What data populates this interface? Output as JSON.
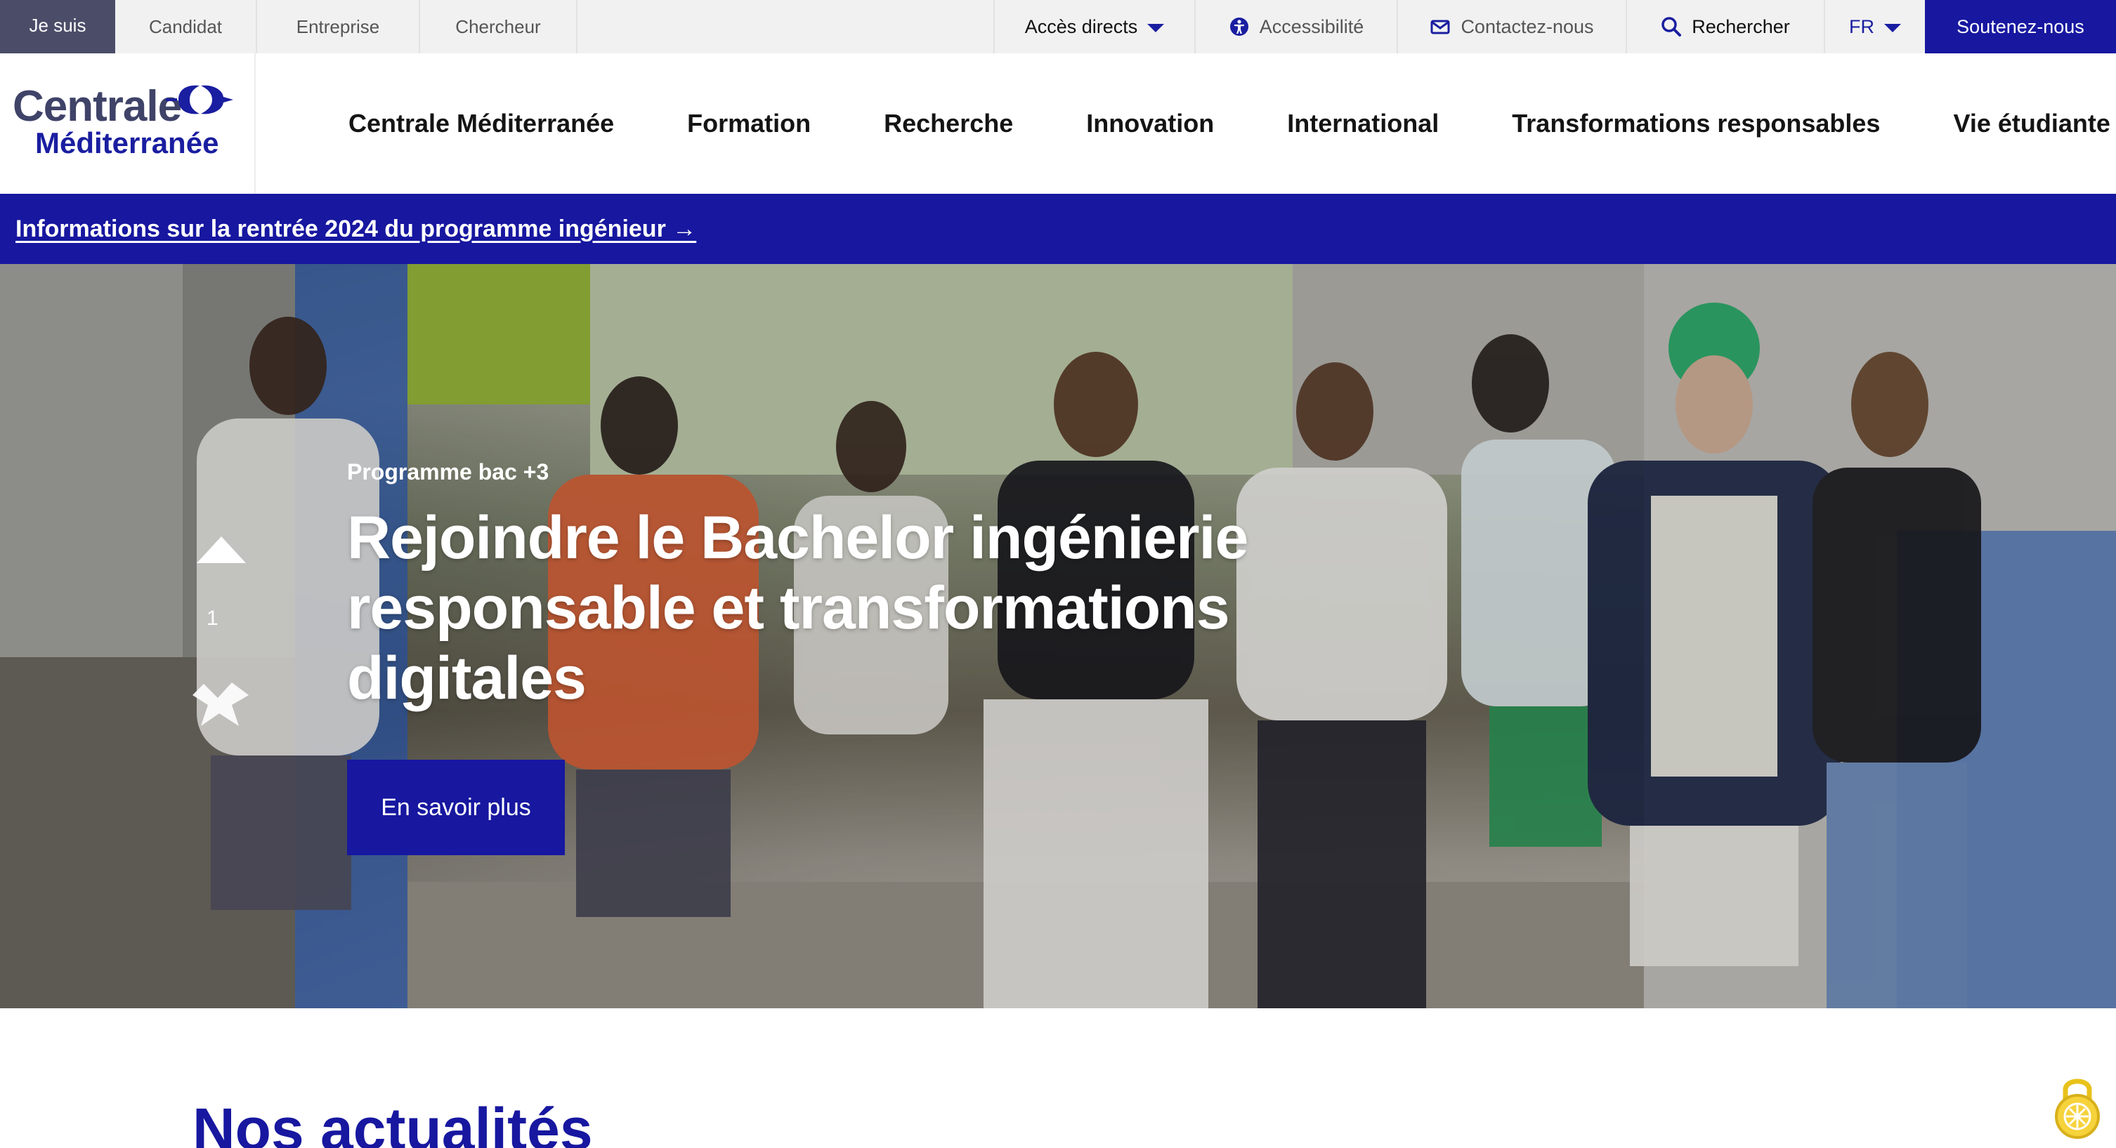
{
  "topbar": {
    "je_suis": "Je suis",
    "roles": [
      "Candidat",
      "Entreprise",
      "Chercheur"
    ],
    "acces_directs": "Accès directs",
    "accessibilite": "Accessibilité",
    "contact": "Contactez-nous",
    "search": "Rechercher",
    "lang": "FR",
    "support": "Soutenez-nous"
  },
  "logo": {
    "line1": "Centrale",
    "line2": "Méditerranée"
  },
  "nav": {
    "items": [
      "Centrale Méditerranée",
      "Formation",
      "Recherche",
      "Innovation",
      "International",
      "Transformations responsables",
      "Vie étudiante"
    ]
  },
  "announcement": {
    "text": "Informations sur la rentrée 2024 du programme ingénieur →"
  },
  "hero": {
    "subtitle": "Programme bac +3",
    "title": "Rejoindre le Bachelor ingénierie responsable et transformations digitales",
    "button": "En savoir plus"
  },
  "news": {
    "title": "Nos actualités"
  },
  "colors": {
    "brand_blue": "#1717a0",
    "logo_gray": "#3f4368",
    "topbar_bg": "#f1f1f2",
    "jesuis_bg": "#4b4d68"
  },
  "icons": [
    "caret-down-icon",
    "accessibility-icon",
    "mail-icon",
    "search-icon",
    "cookie-lock-icon"
  ]
}
